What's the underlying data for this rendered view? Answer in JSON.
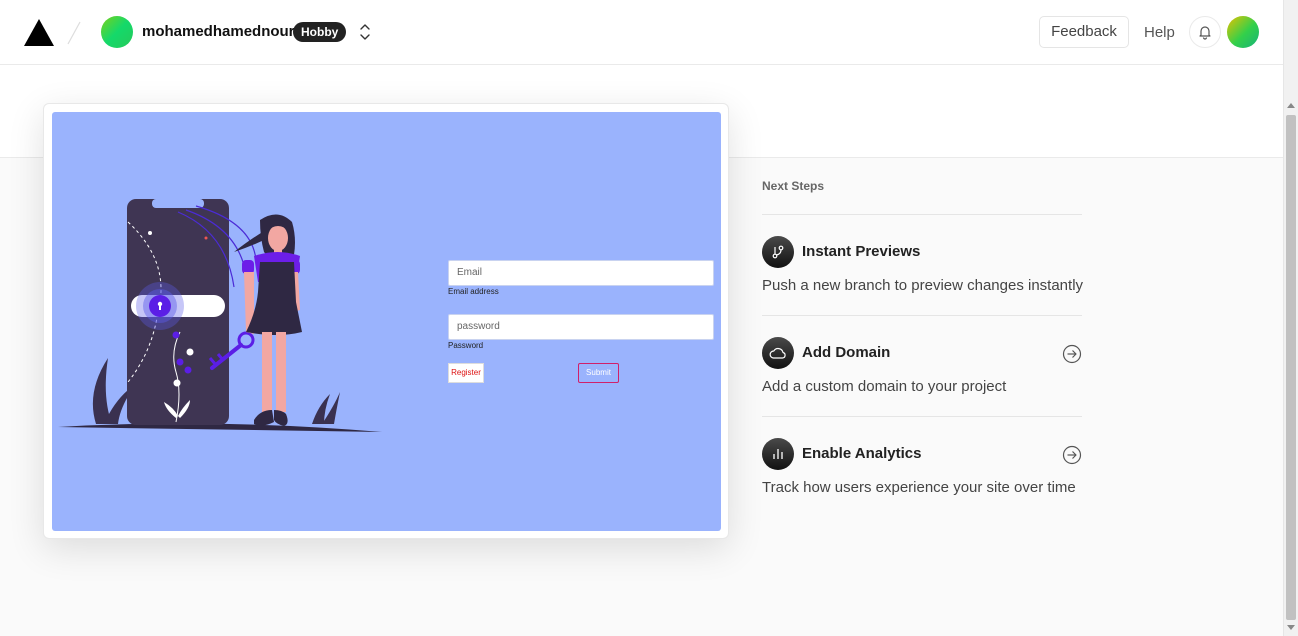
{
  "header": {
    "team_name": "mohamedhamednour",
    "plan_badge": "Hobby",
    "feedback_label": "Feedback",
    "help_label": "Help"
  },
  "preview": {
    "email_placeholder": "Email",
    "email_label": "Email address",
    "password_placeholder": "password",
    "password_label": "Password",
    "register_label": "Register",
    "submit_label": "Submit"
  },
  "next_steps": {
    "title": "Next Steps",
    "items": [
      {
        "title": "Instant Previews",
        "description": "Push a new branch to preview changes instantly",
        "icon": "git-branch-icon",
        "has_arrow": false
      },
      {
        "title": "Add Domain",
        "description": "Add a custom domain to your project",
        "icon": "cloud-icon",
        "has_arrow": true
      },
      {
        "title": "Enable Analytics",
        "description": "Track how users experience your site over time",
        "icon": "bar-chart-icon",
        "has_arrow": true
      }
    ]
  },
  "colors": {
    "preview_background": "#9ab3fd",
    "accent_purple": "#5b1ee6",
    "text_primary": "#222222",
    "badge_background": "#222222"
  }
}
